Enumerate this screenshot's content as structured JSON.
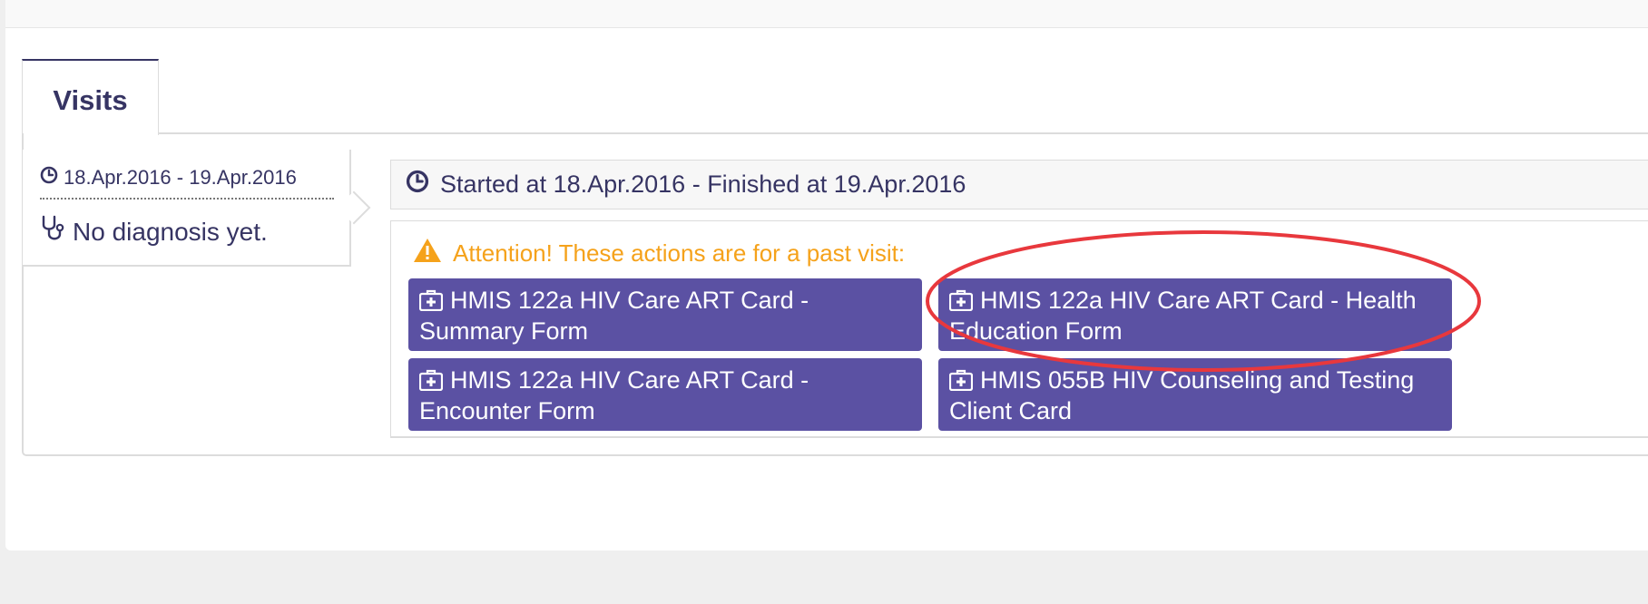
{
  "tabs": {
    "visits_label": "Visits"
  },
  "visit_list": {
    "item": {
      "dates": "18.Apr.2016 - 19.Apr.2016",
      "diagnosis": "No diagnosis yet."
    }
  },
  "visit_detail": {
    "header": "Started at 18.Apr.2016 - Finished at 19.Apr.2016",
    "attention": "Attention! These actions are for a past visit:",
    "actions": [
      {
        "label": "HMIS 122a HIV Care ART Card - Summary Form"
      },
      {
        "label": "HMIS 122a HIV Care ART Card - Health Education Form"
      },
      {
        "label": "HMIS 122a HIV Care ART Card - Encounter Form"
      },
      {
        "label": "HMIS 055B HIV Counseling and Testing Client Card"
      }
    ]
  },
  "icons": {
    "clock": "clock-icon",
    "stethoscope": "stethoscope-icon",
    "warning": "warning-icon",
    "medkit": "medkit-icon"
  },
  "colors": {
    "primary": "#363463",
    "button": "#5b51a3",
    "warning": "#f5a21b",
    "annotation": "#e8383d"
  }
}
